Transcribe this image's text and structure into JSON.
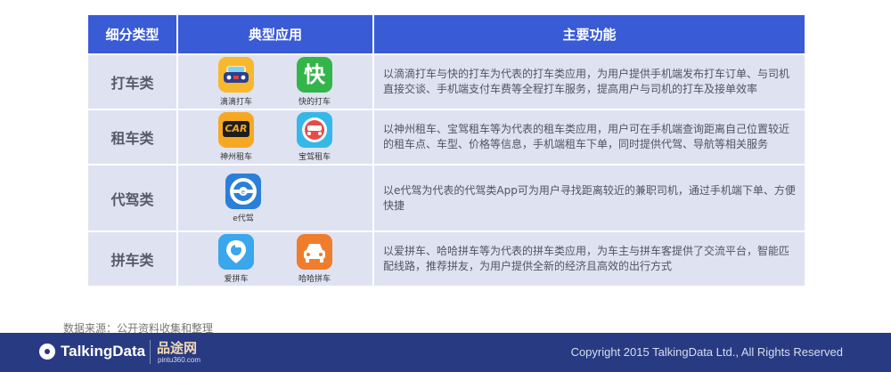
{
  "table": {
    "headers": [
      "细分类型",
      "典型应用",
      "主要功能"
    ],
    "rows": [
      {
        "category": "打车类",
        "apps": [
          {
            "label": "滴滴打车",
            "icon": "didi-taxi-icon",
            "color": "#f8b82e"
          },
          {
            "label": "快的打车",
            "icon": "kuaidi-taxi-icon",
            "color": "#33b54a",
            "glyph": "快"
          }
        ],
        "description": "以滴滴打车与快的打车为代表的打车类应用，为用户提供手机端发布打车订单、与司机直接交谈、手机端支付车费等全程打车服务，提高用户与司机的打车及接单效率"
      },
      {
        "category": "租车类",
        "apps": [
          {
            "label": "神州租车",
            "icon": "car-logo-icon",
            "color": "#f7a823",
            "glyph": "CAR"
          },
          {
            "label": "宝驾租车",
            "icon": "car-face-icon",
            "color": "#35b8e8"
          }
        ],
        "description": "以神州租车、宝驾租车等为代表的租车类应用，用户可在手机端查询距离自己位置较近的租车点、车型、价格等信息，手机端租车下单，同时提供代驾、导航等相关服务"
      },
      {
        "category": "代驾类",
        "apps": [
          {
            "label": "e代驾",
            "icon": "steering-wheel-icon",
            "color": "#2b7fd8"
          }
        ],
        "description": "以e代驾为代表的代驾类App可为用户寻找距离较近的兼职司机，通过手机端下单、方便快捷"
      },
      {
        "category": "拼车类",
        "apps": [
          {
            "label": "爱拼车",
            "icon": "location-pin-icon",
            "color": "#3aa6ec"
          },
          {
            "label": "哈哈拼车",
            "icon": "car-front-icon",
            "color": "#f07d2b"
          }
        ],
        "description": "以爱拼车、哈哈拼车等为代表的拼车类应用，为车主与拼车客提供了交流平台，智能匹配线路，推荐拼友，为用户提供全新的经济且高效的出行方式"
      }
    ]
  },
  "source": "数据来源：公开资料收集和整理",
  "footer": {
    "brand": "TalkingData",
    "partner": "品途网",
    "partner_url": "pintu360.com",
    "copyright": "Copyright 2015 TalkingData Ltd., All Rights Reserved"
  },
  "colors": {
    "header": "#3a5bd6",
    "cell": "#dfe2f1",
    "footer": "#283b82"
  }
}
